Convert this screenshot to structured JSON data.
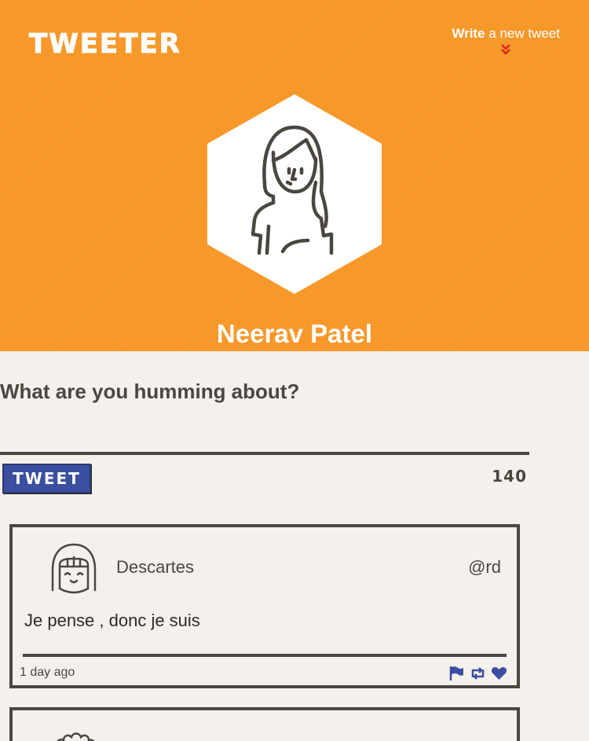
{
  "header": {
    "brand": "TWEETER",
    "compose_bold": "Write",
    "compose_rest": " a new tweet",
    "user_name": "Neerav Patel"
  },
  "composer": {
    "prompt": "What are you humming about?",
    "value": "",
    "button_label": "TWEET",
    "counter": "140"
  },
  "tweets": [
    {
      "author": "Descartes",
      "handle": "@rd",
      "content": "Je pense , donc je suis",
      "time": "1 day ago",
      "actions": [
        "flag-icon",
        "retweet-icon",
        "heart-icon"
      ]
    }
  ],
  "colors": {
    "header_bg": "#f7982a",
    "accent_blue": "#3b4fa0",
    "text_dark": "#4a4640",
    "page_bg": "#f4f1ec",
    "chevron_red": "#e8231b"
  }
}
